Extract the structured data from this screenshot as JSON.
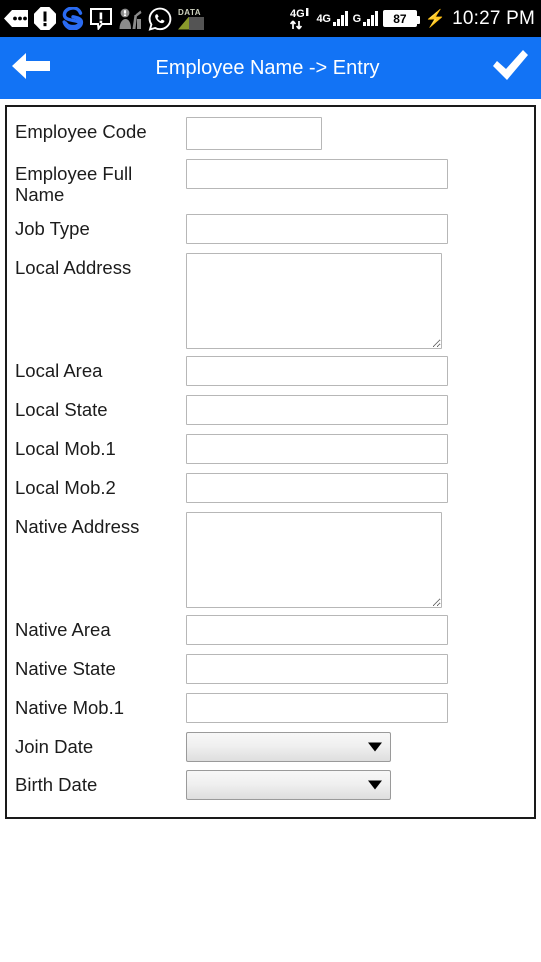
{
  "status_bar": {
    "notification_icons": [
      "sms-message-icon",
      "alert-octagon-icon",
      "s-app-icon",
      "message-alert-icon",
      "person-alert-icon",
      "whatsapp-icon",
      "data-usage-icon"
    ],
    "data_label": "DATA",
    "network_1_label": "4G",
    "network_2_label": "4G",
    "network_3_label": "G",
    "battery_level": "87",
    "charging_icon": "⚡",
    "time": "10:27 PM",
    "background_color": "#000000"
  },
  "app_bar": {
    "back_icon": "arrow-left-icon",
    "title": "Employee Name -> Entry",
    "done_icon": "check-icon",
    "background_color": "#1273f5",
    "text_color": "#ffffff"
  },
  "form": {
    "fields": [
      {
        "label": "Employee Code",
        "type": "text",
        "value": "",
        "placeholder": "",
        "width": "short"
      },
      {
        "label": "Employee Full Name",
        "type": "text",
        "value": "",
        "placeholder": "",
        "width": "full"
      },
      {
        "label": "Job Type",
        "type": "text",
        "value": "",
        "placeholder": "",
        "width": "full"
      },
      {
        "label": "Local Address",
        "type": "textarea",
        "value": "",
        "placeholder": "",
        "width": "full"
      },
      {
        "label": "Local Area",
        "type": "text",
        "value": "",
        "placeholder": "",
        "width": "full"
      },
      {
        "label": "Local State",
        "type": "text",
        "value": "",
        "placeholder": "",
        "width": "full"
      },
      {
        "label": "Local Mob.1",
        "type": "text",
        "value": "",
        "placeholder": "",
        "width": "full"
      },
      {
        "label": "Local Mob.2",
        "type": "text",
        "value": "",
        "placeholder": "",
        "width": "full"
      },
      {
        "label": "Native Address",
        "type": "textarea",
        "value": "",
        "placeholder": "",
        "width": "full"
      },
      {
        "label": "Native Area",
        "type": "text",
        "value": "",
        "placeholder": "",
        "width": "full"
      },
      {
        "label": "Native State",
        "type": "text",
        "value": "",
        "placeholder": "",
        "width": "full"
      },
      {
        "label": "Native Mob.1",
        "type": "text",
        "value": "",
        "placeholder": "",
        "width": "full"
      },
      {
        "label": "Join Date",
        "type": "select",
        "value": "",
        "placeholder": "",
        "width": "select"
      },
      {
        "label": "Birth Date",
        "type": "select",
        "value": "",
        "placeholder": "",
        "width": "select"
      }
    ]
  }
}
